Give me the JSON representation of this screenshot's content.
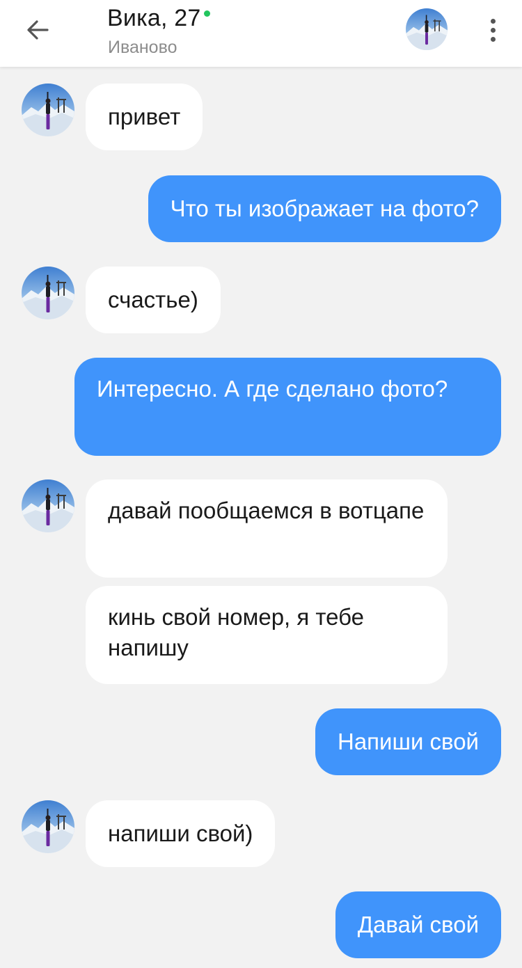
{
  "header": {
    "back_icon": "arrow-left-icon",
    "name": "Вика, 27",
    "online_color": "#22c55e",
    "city": "Иваново",
    "more_icon": "more-vertical-icon"
  },
  "colors": {
    "outgoing_bubble": "#4094fb",
    "incoming_bubble": "#ffffff",
    "background": "#f2f2f2"
  },
  "messages": [
    {
      "direction": "incoming",
      "text": "привет"
    },
    {
      "direction": "outgoing",
      "text": "Что ты изображает на фото?"
    },
    {
      "direction": "incoming",
      "text": "счастье)"
    },
    {
      "direction": "outgoing",
      "text": "Интересно. А где сделано фото?"
    },
    {
      "direction": "incoming",
      "text": "давай пообщаемся в вотцапе"
    },
    {
      "direction": "incoming",
      "text": "кинь свой номер, я тебе напишу"
    },
    {
      "direction": "outgoing",
      "text": "Напиши свой"
    },
    {
      "direction": "incoming",
      "text": "напиши свой)"
    },
    {
      "direction": "outgoing",
      "text": "Давай свой"
    }
  ]
}
